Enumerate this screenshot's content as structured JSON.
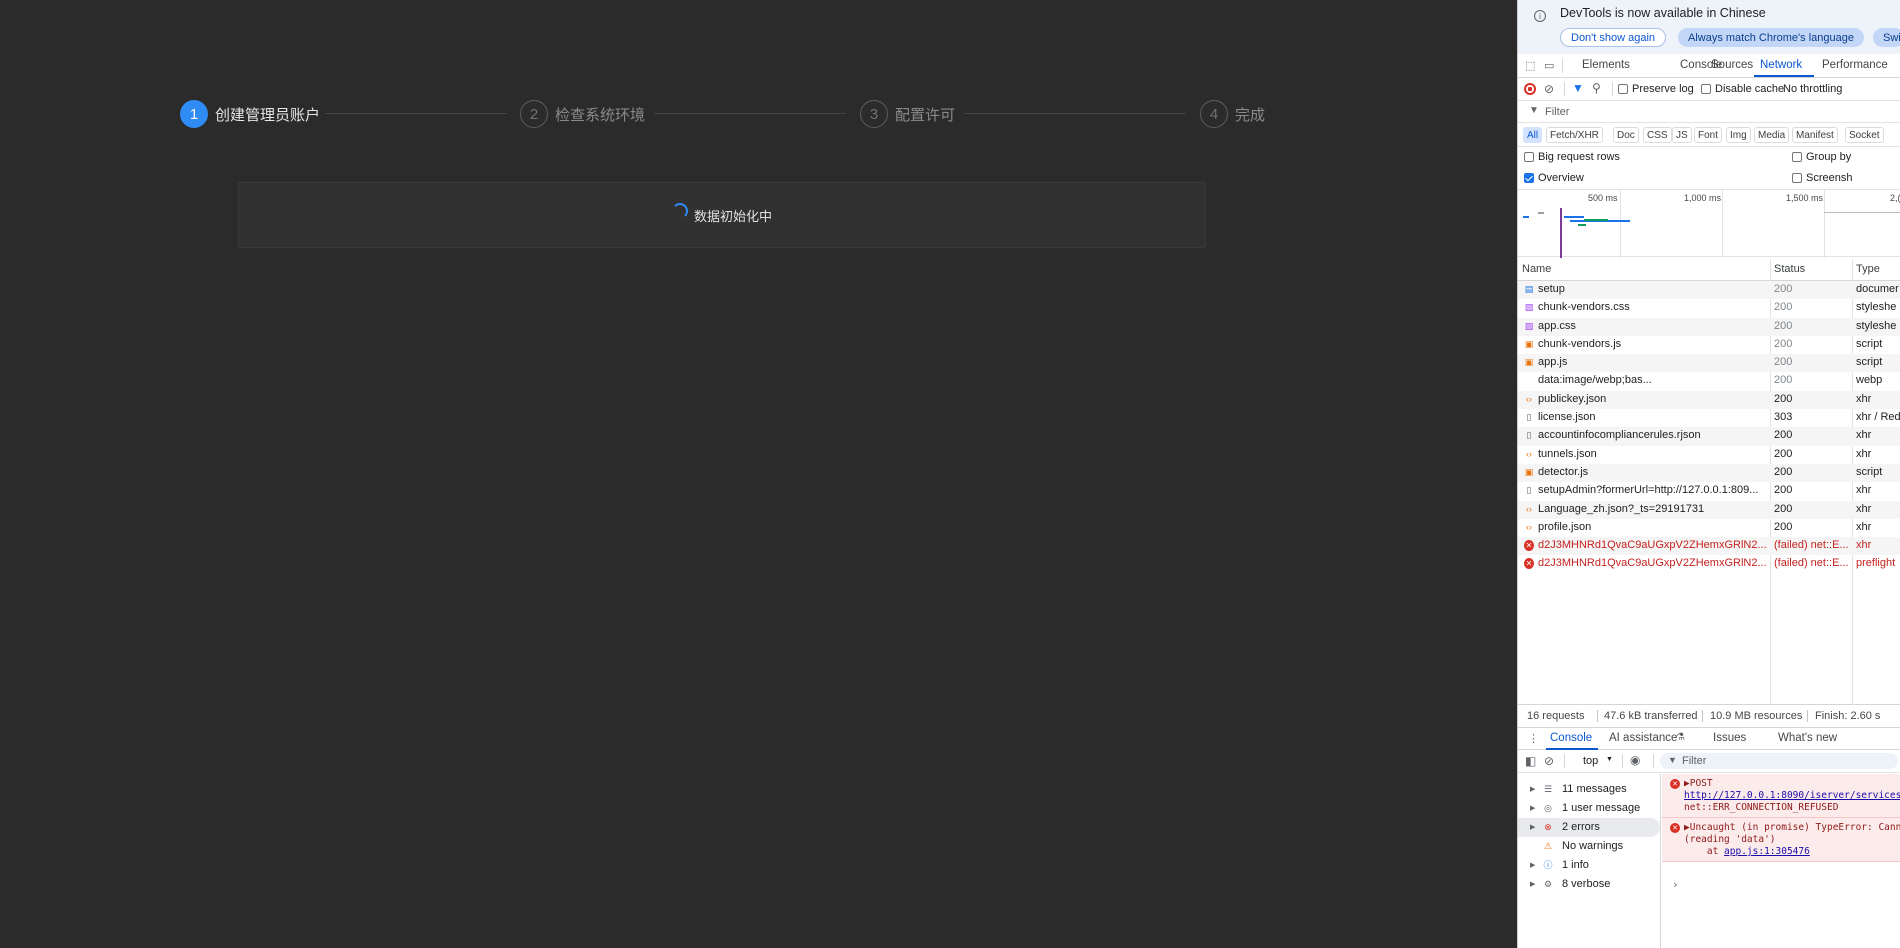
{
  "wizard": {
    "steps": [
      {
        "num": "1",
        "label": "创建管理员账户"
      },
      {
        "num": "2",
        "label": "检查系统环境"
      },
      {
        "num": "3",
        "label": "配置许可"
      },
      {
        "num": "4",
        "label": "完成"
      }
    ],
    "loading_text": "数据初始化中"
  },
  "devtools": {
    "notice": {
      "text": "DevTools is now available in Chinese",
      "btn1": "Don't show again",
      "btn2": "Always match Chrome's language",
      "btn3": "Swit"
    },
    "tabs": [
      "Elements",
      "Console",
      "Sources",
      "Network",
      "Performance"
    ],
    "toolbar": {
      "preserve_log": "Preserve log",
      "disable_cache": "Disable cache",
      "throttling": "No throttling"
    },
    "filter_placeholder": "Filter",
    "type_filters": [
      "All",
      "Fetch/XHR",
      "Doc",
      "CSS",
      "JS",
      "Font",
      "Img",
      "Media",
      "Manifest",
      "Socket"
    ],
    "options": {
      "big_rows": "Big request rows",
      "group_by": "Group by",
      "overview": "Overview",
      "screenshots": "Screensh"
    },
    "overview_ticks": [
      "500 ms",
      "1,000 ms",
      "1,500 ms",
      "2,("
    ],
    "columns": {
      "name": "Name",
      "status": "Status",
      "type": "Type"
    },
    "requests": [
      {
        "name": "setup",
        "status": "200",
        "type": "documer",
        "icon": "doc",
        "err": false
      },
      {
        "name": "chunk-vendors.css",
        "status": "200",
        "type": "styleshe",
        "icon": "css",
        "err": false
      },
      {
        "name": "app.css",
        "status": "200",
        "type": "styleshe",
        "icon": "css",
        "err": false
      },
      {
        "name": "chunk-vendors.js",
        "status": "200",
        "type": "script",
        "icon": "js",
        "err": false
      },
      {
        "name": "app.js",
        "status": "200",
        "type": "script",
        "icon": "js",
        "err": false
      },
      {
        "name": "data:image/webp;bas...",
        "status": "200",
        "type": "webp",
        "icon": "none",
        "err": false
      },
      {
        "name": "publickey.json",
        "status": "200",
        "type": "xhr",
        "icon": "json",
        "err": false
      },
      {
        "name": "license.json",
        "status": "303",
        "type": "xhr / Red",
        "icon": "file",
        "err": false
      },
      {
        "name": "accountinfocompliancerules.rjson",
        "status": "200",
        "type": "xhr",
        "icon": "file",
        "err": false
      },
      {
        "name": "tunnels.json",
        "status": "200",
        "type": "xhr",
        "icon": "json",
        "err": false
      },
      {
        "name": "detector.js",
        "status": "200",
        "type": "script",
        "icon": "js",
        "err": false
      },
      {
        "name": "setupAdmin?formerUrl=http://127.0.0.1:809...",
        "status": "200",
        "type": "xhr",
        "icon": "file",
        "err": false
      },
      {
        "name": "Language_zh.json?_ts=29191731",
        "status": "200",
        "type": "xhr",
        "icon": "json",
        "err": false
      },
      {
        "name": "profile.json",
        "status": "200",
        "type": "xhr",
        "icon": "json",
        "err": false
      },
      {
        "name": "d2J3MHNRd1QvaC9aUGxpV2ZHemxGRlN2...",
        "status": "(failed) net::E...",
        "type": "xhr",
        "icon": "err",
        "err": true
      },
      {
        "name": "d2J3MHNRd1QvaC9aUGxpV2ZHemxGRlN2...",
        "status": "(failed) net::E...",
        "type": "preflight",
        "icon": "err",
        "err": true
      }
    ],
    "summary": {
      "requests": "16 requests",
      "transferred": "47.6 kB transferred",
      "resources": "10.9 MB resources",
      "finish": "Finish: 2.60 s"
    },
    "drawer_tabs": [
      "Console",
      "AI assistance",
      "Issues",
      "What's new"
    ],
    "console": {
      "context": "top",
      "filter_placeholder": "Filter",
      "sidebar": [
        {
          "label": "11 messages",
          "icon": "list"
        },
        {
          "label": "1 user message",
          "icon": "user"
        },
        {
          "label": "2 errors",
          "icon": "error"
        },
        {
          "label": "No warnings",
          "icon": "warning"
        },
        {
          "label": "1 info",
          "icon": "info"
        },
        {
          "label": "8 verbose",
          "icon": "verbose"
        }
      ],
      "msg1": {
        "line1": "▶POST",
        "link": "http://127.0.0.1:8090/iserver/services/se",
        "line3": "net::ERR_CONNECTION_REFUSED"
      },
      "msg2": {
        "line1": "▶Uncaught (in promise) TypeError: Cannot",
        "line2": "(reading 'data')",
        "line3_prefix": "    at ",
        "link": "app.js:1:305476"
      },
      "prompt": "›"
    }
  }
}
